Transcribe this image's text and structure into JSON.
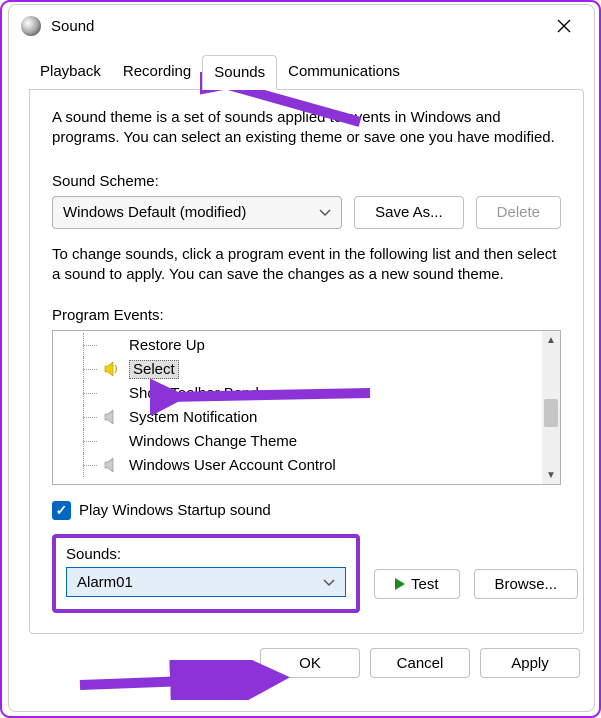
{
  "window": {
    "title": "Sound"
  },
  "tabs": [
    "Playback",
    "Recording",
    "Sounds",
    "Communications"
  ],
  "active_tab_index": 2,
  "description": "A sound theme is a set of sounds applied to events in Windows and programs. You can select an existing theme or save one you have modified.",
  "scheme": {
    "label": "Sound Scheme:",
    "value": "Windows Default (modified)",
    "save_as": "Save As...",
    "delete": "Delete"
  },
  "instruction": "To change sounds, click a program event in the following list and then select a sound to apply. You can save the changes as a new sound theme.",
  "events": {
    "label": "Program Events:",
    "items": [
      {
        "name": "Restore Up",
        "has_sound": false
      },
      {
        "name": "Select",
        "has_sound": true,
        "selected": true
      },
      {
        "name": "Show Toolbar Band",
        "has_sound": false
      },
      {
        "name": "System Notification",
        "has_sound": true
      },
      {
        "name": "Windows Change Theme",
        "has_sound": false
      },
      {
        "name": "Windows User Account Control",
        "has_sound": true
      }
    ]
  },
  "startup_checkbox": {
    "checked": true,
    "label": "Play Windows Startup sound"
  },
  "sounds": {
    "label": "Sounds:",
    "value": "Alarm01",
    "test": "Test",
    "browse": "Browse..."
  },
  "footer": {
    "ok": "OK",
    "cancel": "Cancel",
    "apply": "Apply"
  },
  "colors": {
    "highlight_purple": "#8b33d6",
    "accent_blue": "#0067c0"
  }
}
